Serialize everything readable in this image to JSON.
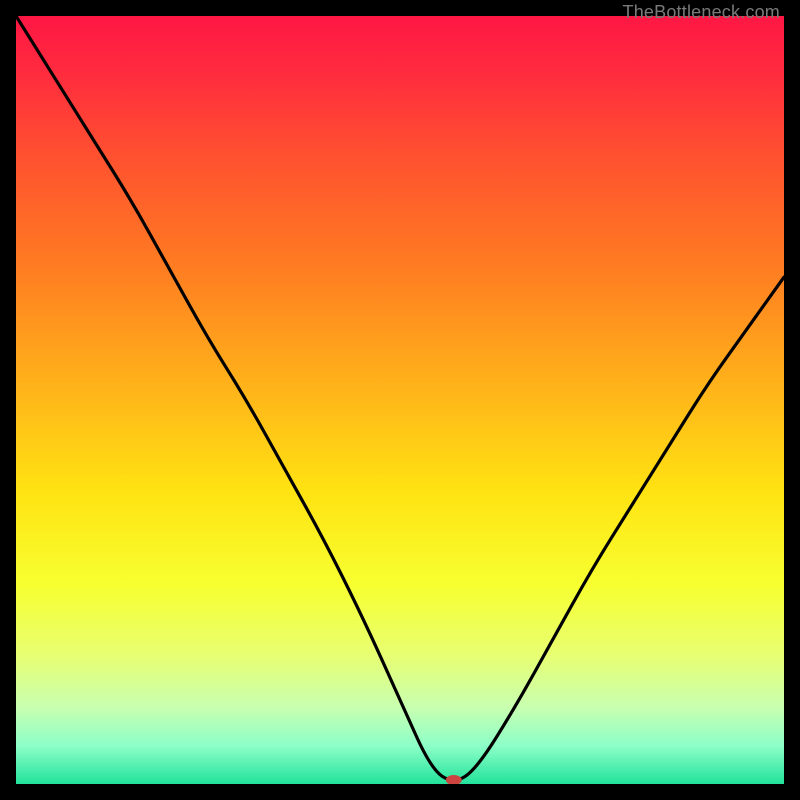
{
  "watermark": "TheBottleneck.com",
  "chart_data": {
    "type": "line",
    "title": "",
    "xlabel": "",
    "ylabel": "",
    "xlim": [
      0,
      100
    ],
    "ylim": [
      0,
      100
    ],
    "grid": false,
    "background": "red-yellow-green-vertical-gradient",
    "series": [
      {
        "name": "bottleneck-curve",
        "x": [
          0,
          5,
          10,
          15,
          20,
          25,
          30,
          35,
          40,
          45,
          50,
          54,
          57,
          60,
          65,
          70,
          75,
          80,
          85,
          90,
          95,
          100
        ],
        "y": [
          100,
          92,
          84,
          76,
          67,
          58,
          50,
          41,
          32,
          22,
          11,
          2,
          0,
          2,
          10,
          19,
          28,
          36,
          44,
          52,
          59,
          66
        ]
      }
    ],
    "marker": {
      "x": 57,
      "y": 0,
      "color": "#cc463f",
      "rx": 8,
      "ry": 5
    }
  },
  "colors": {
    "gradient_stops": [
      {
        "offset": 0.0,
        "color": "#ff1744"
      },
      {
        "offset": 0.07,
        "color": "#ff2a3f"
      },
      {
        "offset": 0.18,
        "color": "#ff5030"
      },
      {
        "offset": 0.32,
        "color": "#ff7a22"
      },
      {
        "offset": 0.48,
        "color": "#ffb21a"
      },
      {
        "offset": 0.62,
        "color": "#ffe312"
      },
      {
        "offset": 0.74,
        "color": "#f7ff30"
      },
      {
        "offset": 0.83,
        "color": "#e8ff70"
      },
      {
        "offset": 0.9,
        "color": "#c8ffb0"
      },
      {
        "offset": 0.95,
        "color": "#8dffc8"
      },
      {
        "offset": 1.0,
        "color": "#22e29b"
      }
    ]
  }
}
